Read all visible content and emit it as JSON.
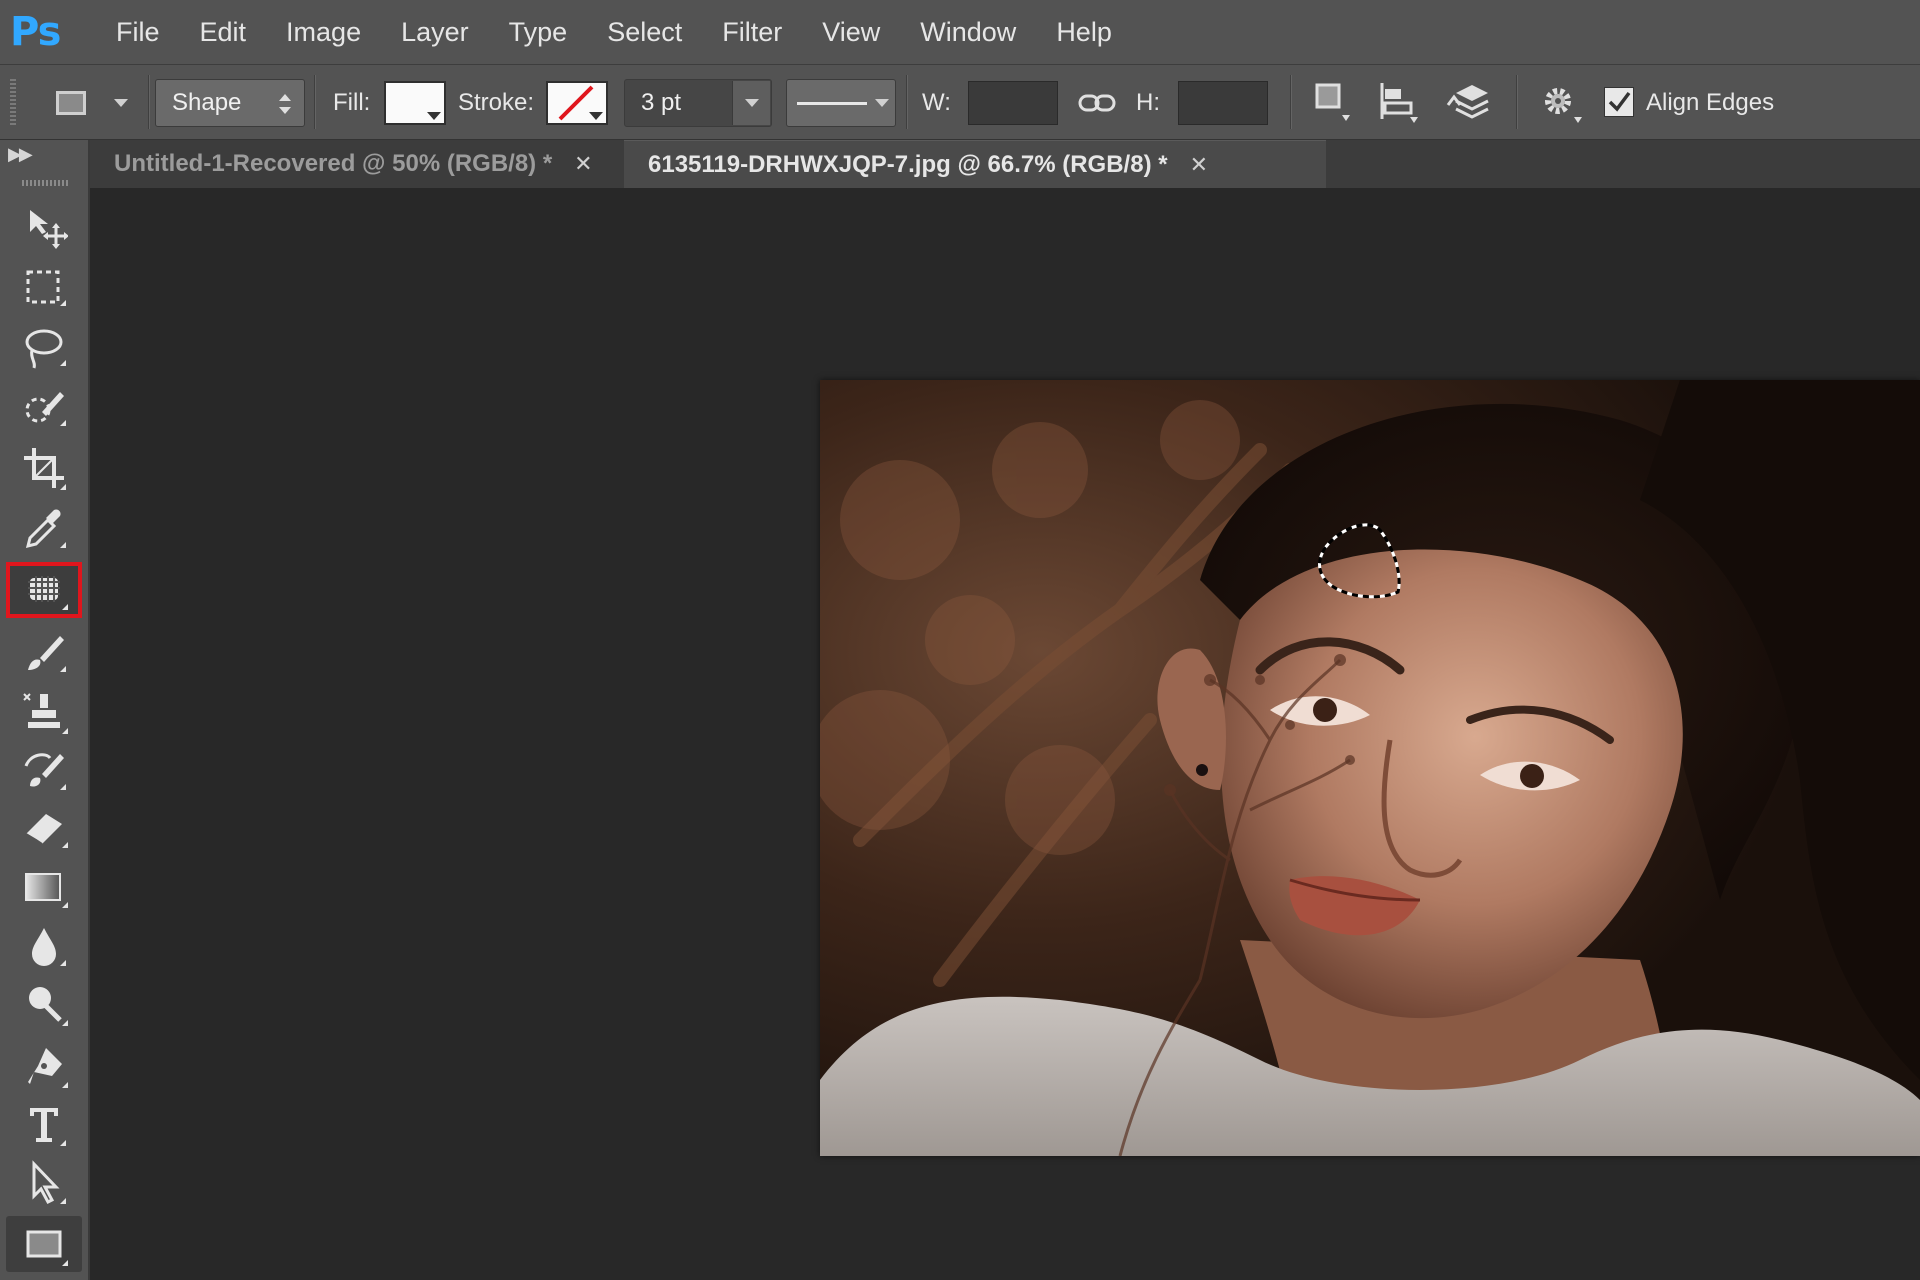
{
  "app": {
    "logo": "Ps"
  },
  "menu": [
    "File",
    "Edit",
    "Image",
    "Layer",
    "Type",
    "Select",
    "Filter",
    "View",
    "Window",
    "Help"
  ],
  "options": {
    "mode": "Shape",
    "fill_label": "Fill:",
    "stroke_label": "Stroke:",
    "stroke_width": "3 pt",
    "w_label": "W:",
    "h_label": "H:",
    "align_edges_label": "Align Edges",
    "align_edges_checked": true
  },
  "tabs": [
    {
      "label": "Untitled-1-Recovered @ 50% (RGB/8) *",
      "active": false
    },
    {
      "label": "6135119-DRHWXJQP-7.jpg @ 66.7% (RGB/8) *",
      "active": true
    }
  ],
  "tools": [
    "move-tool",
    "rectangular-marquee-tool",
    "lasso-tool",
    "quick-selection-tool",
    "crop-tool",
    "eyedropper-tool",
    "patch-tool",
    "brush-tool",
    "clone-stamp-tool",
    "history-brush-tool",
    "eraser-tool",
    "gradient-tool",
    "blur-tool",
    "dodge-tool",
    "pen-tool",
    "type-tool",
    "path-selection-tool",
    "rectangle-tool"
  ],
  "selected_tool": "patch-tool",
  "colors": {
    "highlight": "#e0161d",
    "ps_blue": "#31a8ff"
  }
}
